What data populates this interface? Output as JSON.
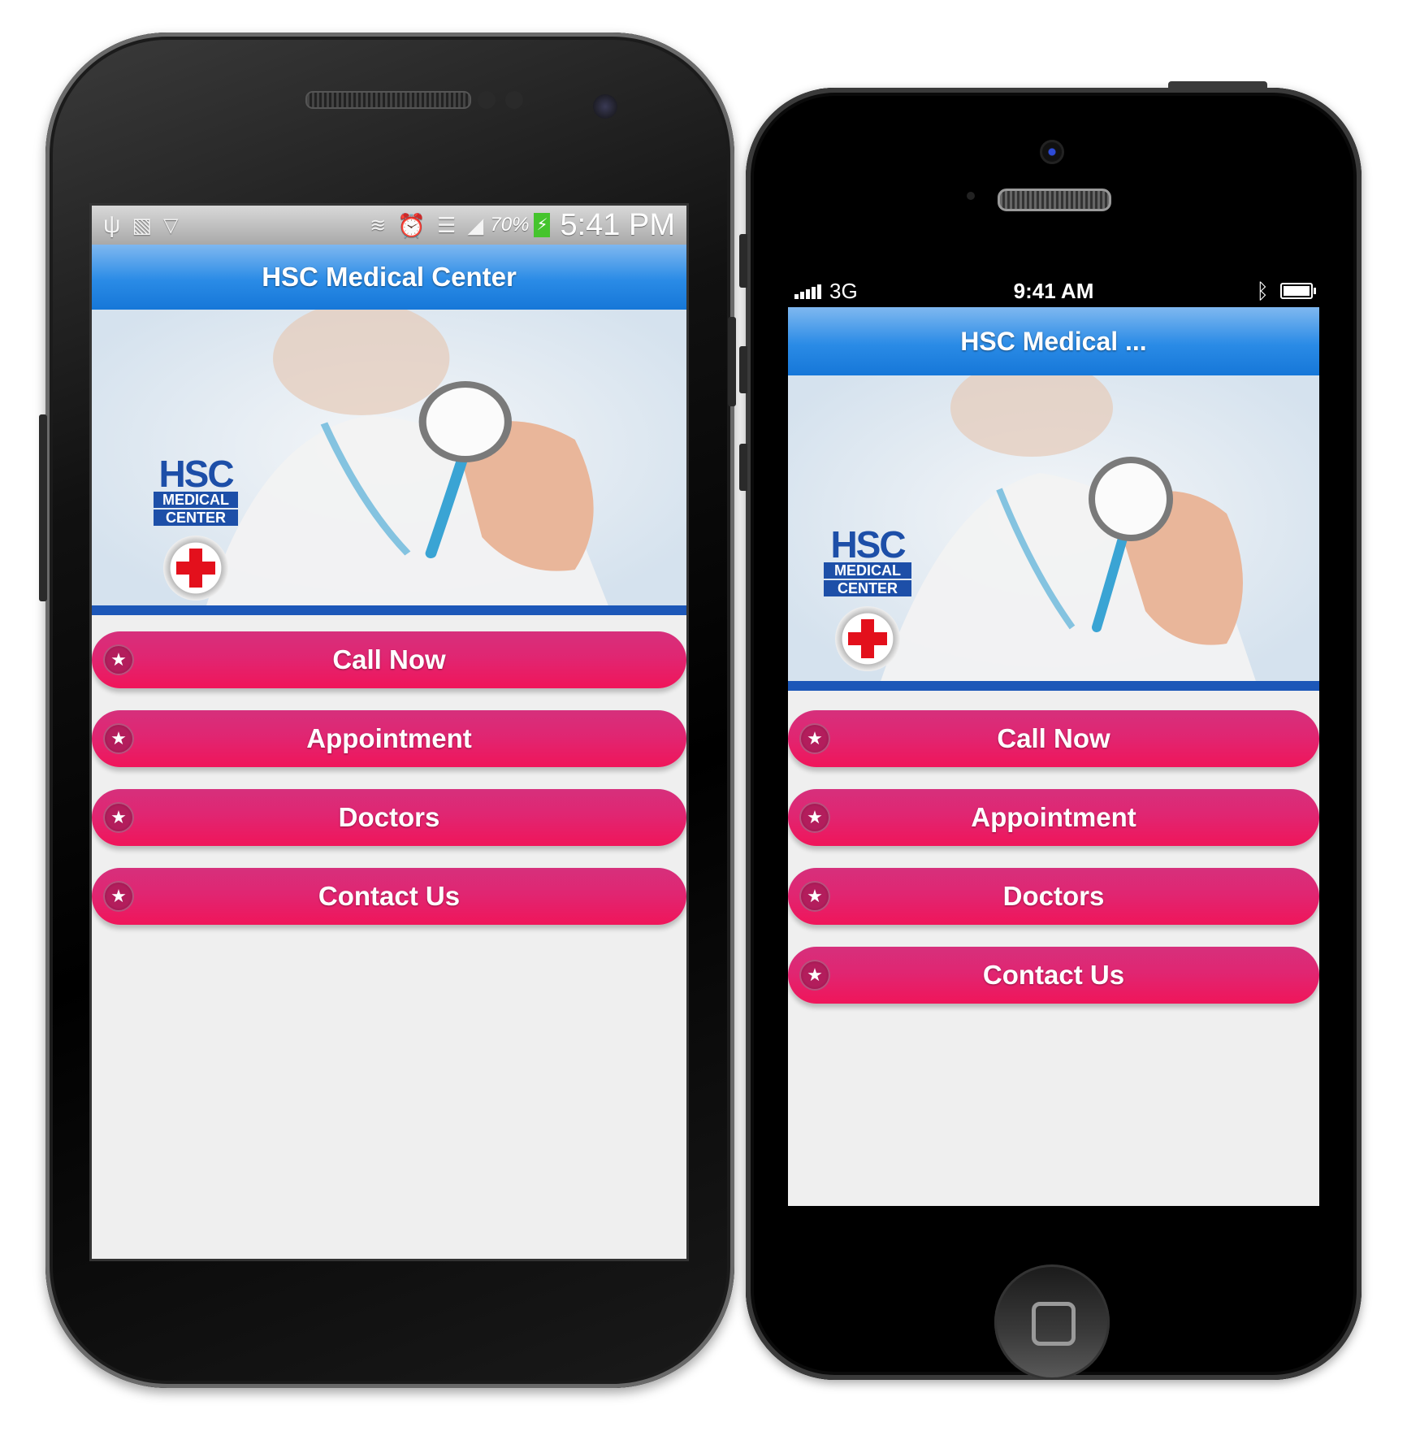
{
  "android": {
    "status_bar": {
      "battery": "70%",
      "time": "5:41 PM",
      "icons": [
        "usb-icon",
        "image-icon",
        "notification-icon",
        "vibrate-icon",
        "alarm-icon",
        "wifi-icon",
        "signal-icon",
        "battery-charging-icon"
      ]
    },
    "title": "HSC Medical Center"
  },
  "iphone": {
    "status_bar": {
      "network": "3G",
      "time": "9:41 AM",
      "icons": [
        "signal-bars-icon",
        "bluetooth-icon",
        "battery-icon"
      ]
    },
    "title": "HSC Medical ..."
  },
  "logo": {
    "line1": "HSC",
    "line2": "MEDICAL",
    "line3": "CENTER"
  },
  "menu": {
    "items": [
      {
        "label": "Call Now"
      },
      {
        "label": "Appointment"
      },
      {
        "label": "Doctors"
      },
      {
        "label": "Contact Us"
      }
    ],
    "icon": "star-icon"
  },
  "colors": {
    "title_bar": "#2a8be6",
    "menu_button": "#e02672",
    "hero_underline": "#1c57b8"
  }
}
